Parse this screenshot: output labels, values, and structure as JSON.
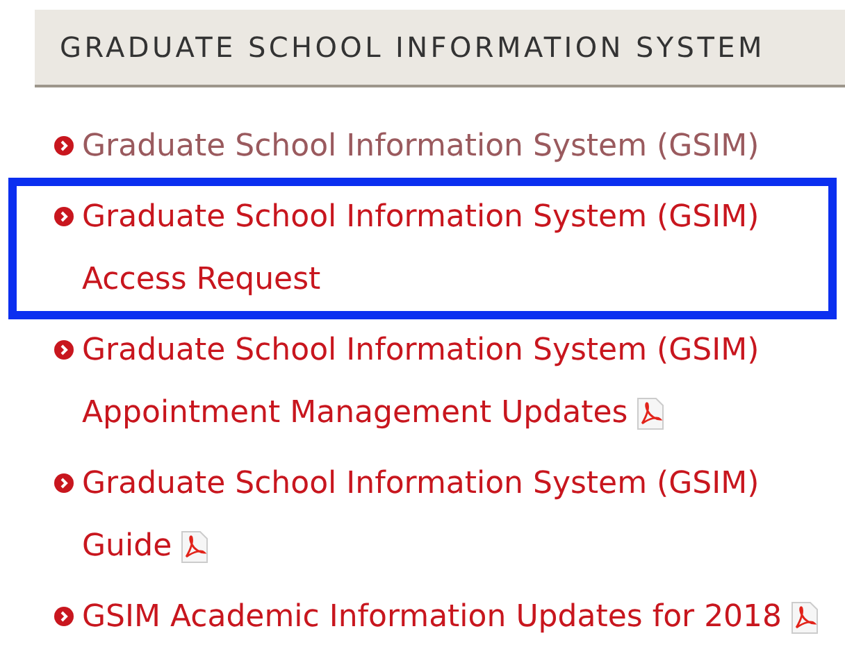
{
  "header": {
    "title": "GRADUATE SCHOOL INFORMATION SYSTEM"
  },
  "links": [
    {
      "text": "Graduate School Information System (GSIM)",
      "visited": true,
      "highlighted": false,
      "pdf": false
    },
    {
      "text": "Graduate School Information System (GSIM) Access Request",
      "visited": false,
      "highlighted": true,
      "pdf": false
    },
    {
      "text": "Graduate School Information System (GSIM) Appointment Management Updates",
      "visited": false,
      "highlighted": false,
      "pdf": true
    },
    {
      "text": "Graduate School Information System (GSIM) Guide",
      "visited": false,
      "highlighted": false,
      "pdf": true
    },
    {
      "text": "GSIM Academic Information Updates for 2018",
      "visited": false,
      "highlighted": false,
      "pdf": true
    }
  ]
}
